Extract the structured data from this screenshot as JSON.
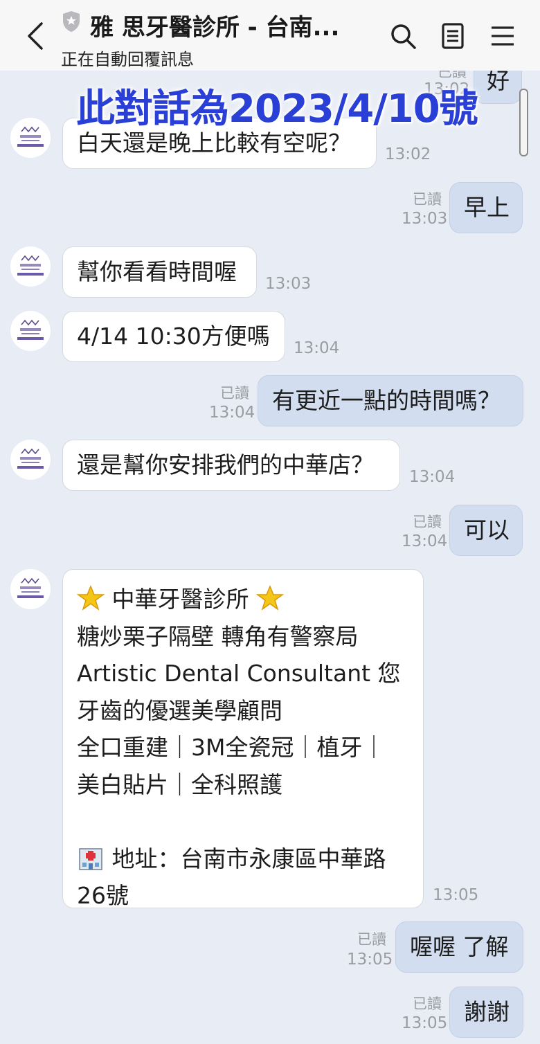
{
  "header": {
    "title": "雅 思牙醫診所 - 台南...",
    "subtitle": "正在自動回覆訊息"
  },
  "watermark": "此對話為2023/4/10號",
  "messages": [
    {
      "side": "out",
      "text": "好",
      "read": "已讀",
      "time": "13:02"
    },
    {
      "side": "in",
      "text": "白天還是晚上比較有空呢？",
      "time": "13:02"
    },
    {
      "side": "out",
      "text": "早上",
      "read": "已讀",
      "time": "13:03"
    },
    {
      "side": "in",
      "text": "幫你看看時間喔",
      "time": "13:03"
    },
    {
      "side": "in",
      "text": "4/14 10:30方便嗎",
      "time": "13:04"
    },
    {
      "side": "out",
      "text": "有更近一點的時間嗎？",
      "read": "已讀",
      "time": "13:04"
    },
    {
      "side": "in",
      "text": "還是幫你安排我們的中華店？",
      "time": "13:04"
    },
    {
      "side": "out",
      "text": "可以",
      "read": "已讀",
      "time": "13:04"
    },
    {
      "side": "in",
      "lines": [
        "中華牙醫診所",
        "糖炒栗子隔壁 轉角有警察局",
        "Artistic Dental Consultant 您",
        "牙齒的優選美學顧問",
        "全口重建｜3M全瓷冠｜植牙｜",
        "美白貼片｜全科照護",
        "",
        "地址：台南市永康區中華路",
        "26號"
      ],
      "time": "13:05"
    },
    {
      "side": "out",
      "text": "喔喔 了解",
      "read": "已讀",
      "time": "13:05"
    },
    {
      "side": "out",
      "text": "謝謝",
      "read": "已讀",
      "time": "13:05"
    }
  ],
  "icons": {
    "back": "chevron-left-icon",
    "verified": "shield-icon",
    "search": "search-icon",
    "notes": "notes-icon",
    "menu": "menu-icon",
    "avatar": "clinic-logo",
    "star": "star-icon",
    "hospital": "hospital-icon"
  },
  "colors": {
    "background": "#e8ecf4",
    "outgoing_bubble": "#d2def0",
    "incoming_bubble": "#ffffff",
    "watermark": "#2a3fd6"
  }
}
